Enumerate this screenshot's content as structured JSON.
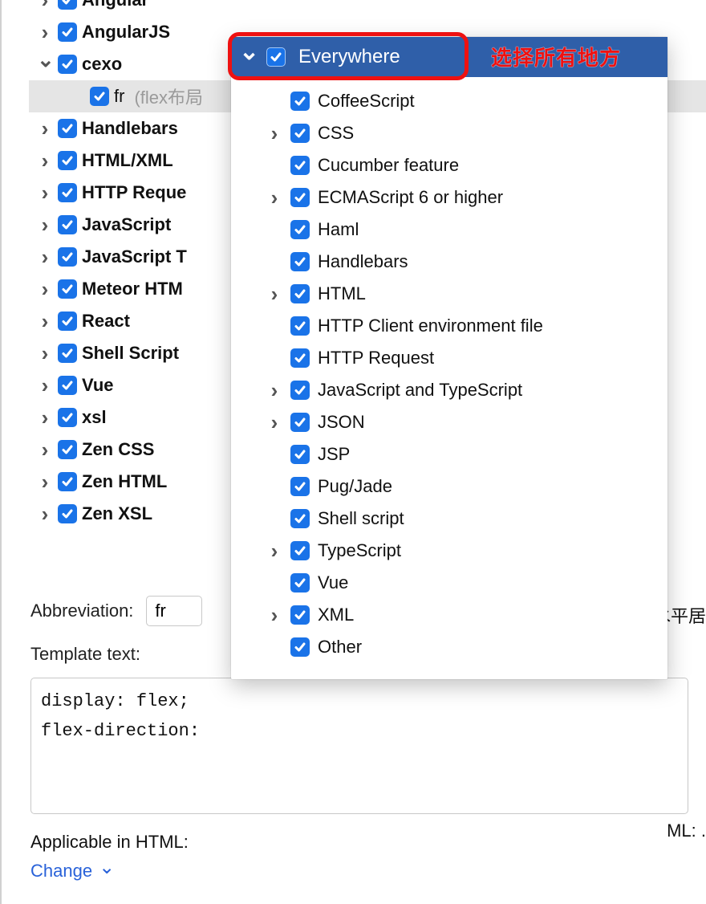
{
  "tree": {
    "items": [
      {
        "label": "Angular",
        "expandable": true,
        "expanded": false,
        "checked": true,
        "selected": false,
        "child": false
      },
      {
        "label": "AngularJS",
        "expandable": true,
        "expanded": false,
        "checked": true,
        "selected": false,
        "child": false
      },
      {
        "label": "cexo",
        "expandable": true,
        "expanded": true,
        "checked": true,
        "selected": false,
        "child": false
      },
      {
        "label": "fr",
        "suffix": "(flex布局",
        "expandable": false,
        "expanded": false,
        "checked": true,
        "selected": true,
        "child": true
      },
      {
        "label": "Handlebars",
        "expandable": true,
        "expanded": false,
        "checked": true,
        "selected": false,
        "child": false
      },
      {
        "label": "HTML/XML",
        "expandable": true,
        "expanded": false,
        "checked": true,
        "selected": false,
        "child": false
      },
      {
        "label": "HTTP Reque",
        "expandable": true,
        "expanded": false,
        "checked": true,
        "selected": false,
        "child": false
      },
      {
        "label": "JavaScript",
        "expandable": true,
        "expanded": false,
        "checked": true,
        "selected": false,
        "child": false
      },
      {
        "label": "JavaScript T",
        "expandable": true,
        "expanded": false,
        "checked": true,
        "selected": false,
        "child": false
      },
      {
        "label": "Meteor HTM",
        "expandable": true,
        "expanded": false,
        "checked": true,
        "selected": false,
        "child": false
      },
      {
        "label": "React",
        "expandable": true,
        "expanded": false,
        "checked": true,
        "selected": false,
        "child": false
      },
      {
        "label": "Shell Script",
        "expandable": true,
        "expanded": false,
        "checked": true,
        "selected": false,
        "child": false
      },
      {
        "label": "Vue",
        "expandable": true,
        "expanded": false,
        "checked": true,
        "selected": false,
        "child": false
      },
      {
        "label": "xsl",
        "expandable": true,
        "expanded": false,
        "checked": true,
        "selected": false,
        "child": false
      },
      {
        "label": "Zen CSS",
        "expandable": true,
        "expanded": false,
        "checked": true,
        "selected": false,
        "child": false
      },
      {
        "label": "Zen HTML",
        "expandable": true,
        "expanded": false,
        "checked": true,
        "selected": false,
        "child": false
      },
      {
        "label": "Zen XSL",
        "expandable": true,
        "expanded": false,
        "checked": true,
        "selected": false,
        "child": false
      }
    ]
  },
  "form": {
    "abbreviation_label": "Abbreviation:",
    "abbreviation_value": "fr",
    "description_cut": "水平居",
    "template_label": "Template text:",
    "template_value": "display: flex;\nflex-direction:",
    "applicable_label": "Applicable in HTML:",
    "applicable_right_cut": "ML: .",
    "change_label": "Change"
  },
  "popup": {
    "header": "Everywhere",
    "items": [
      {
        "label": "CoffeeScript",
        "expandable": false
      },
      {
        "label": "CSS",
        "expandable": true
      },
      {
        "label": "Cucumber feature",
        "expandable": false
      },
      {
        "label": "ECMAScript 6 or higher",
        "expandable": true
      },
      {
        "label": "Haml",
        "expandable": false
      },
      {
        "label": "Handlebars",
        "expandable": false
      },
      {
        "label": "HTML",
        "expandable": true
      },
      {
        "label": "HTTP Client environment file",
        "expandable": false
      },
      {
        "label": "HTTP Request",
        "expandable": false
      },
      {
        "label": "JavaScript and TypeScript",
        "expandable": true
      },
      {
        "label": "JSON",
        "expandable": true
      },
      {
        "label": "JSP",
        "expandable": false
      },
      {
        "label": "Pug/Jade",
        "expandable": false
      },
      {
        "label": "Shell script",
        "expandable": false
      },
      {
        "label": "TypeScript",
        "expandable": true
      },
      {
        "label": "Vue",
        "expandable": false
      },
      {
        "label": "XML",
        "expandable": true
      },
      {
        "label": "Other",
        "expandable": false
      }
    ]
  },
  "annotation": {
    "text": "选择所有地方"
  }
}
